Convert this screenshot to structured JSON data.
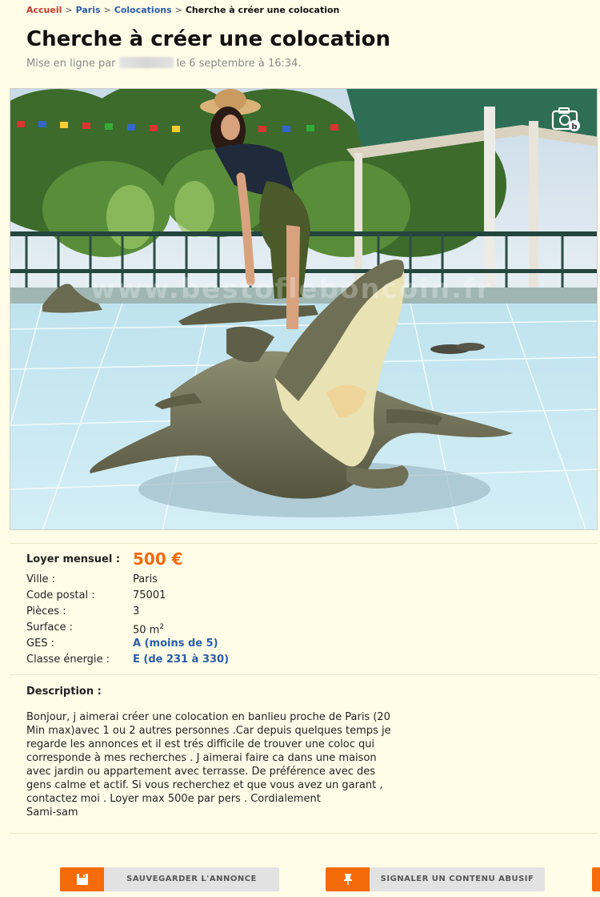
{
  "breadcrumb": {
    "home": "Accueil",
    "city": "Paris",
    "category": "Colocations",
    "current": "Cherche à créer une colocation"
  },
  "ad": {
    "title": "Cherche à créer une colocation",
    "posted_prefix": "Mise en ligne par",
    "posted_suffix": "le 6 septembre à 16:34."
  },
  "photo": {
    "watermark": "www.bestofleboncoin.fr",
    "badge_icon": "camera-icon"
  },
  "details": {
    "rent_label": "Loyer mensuel :",
    "rent_value": "500 €",
    "rows": [
      {
        "label": "Ville :",
        "value": "Paris"
      },
      {
        "label": "Code postal :",
        "value": "75001"
      },
      {
        "label": "Pièces :",
        "value": "3"
      },
      {
        "label": "Surface :",
        "value": "50 m",
        "sup": "2"
      },
      {
        "label": "GES :",
        "value": "A (moins de 5)"
      },
      {
        "label": "Classe énergie :",
        "value": "E (de 231 à 330)"
      }
    ]
  },
  "description": {
    "title": "Description :",
    "lines": [
      "Bonjour, j aimerai créer une colocation en banlieu proche de Paris (20",
      "Min max)avec 1 ou 2 autres personnes .Car depuis quelques temps je",
      "regarde les annonces et il est trés difficile de trouver une coloc qui",
      "corresponde à mes recherches . J aimerai faire ca dans une maison",
      "avec jardin ou appartement avec terrasse. De préférence avec des",
      "gens calme et actif. Si vous recherchez et que vous avez un garant ,",
      "contactez moi . Loyer max 500e par pers . Cordialement",
      "Sami-sam"
    ]
  },
  "actions": {
    "save_label": "SAUVEGARDER L'ANNONCE",
    "save_icon": "floppy-disk-icon",
    "report_label": "SIGNALER UN CONTENU ABUSIF",
    "report_icon": "pin-icon"
  },
  "colors": {
    "accent": "#f56b0a",
    "link": "#2a5ca8",
    "background": "#fffde8"
  }
}
